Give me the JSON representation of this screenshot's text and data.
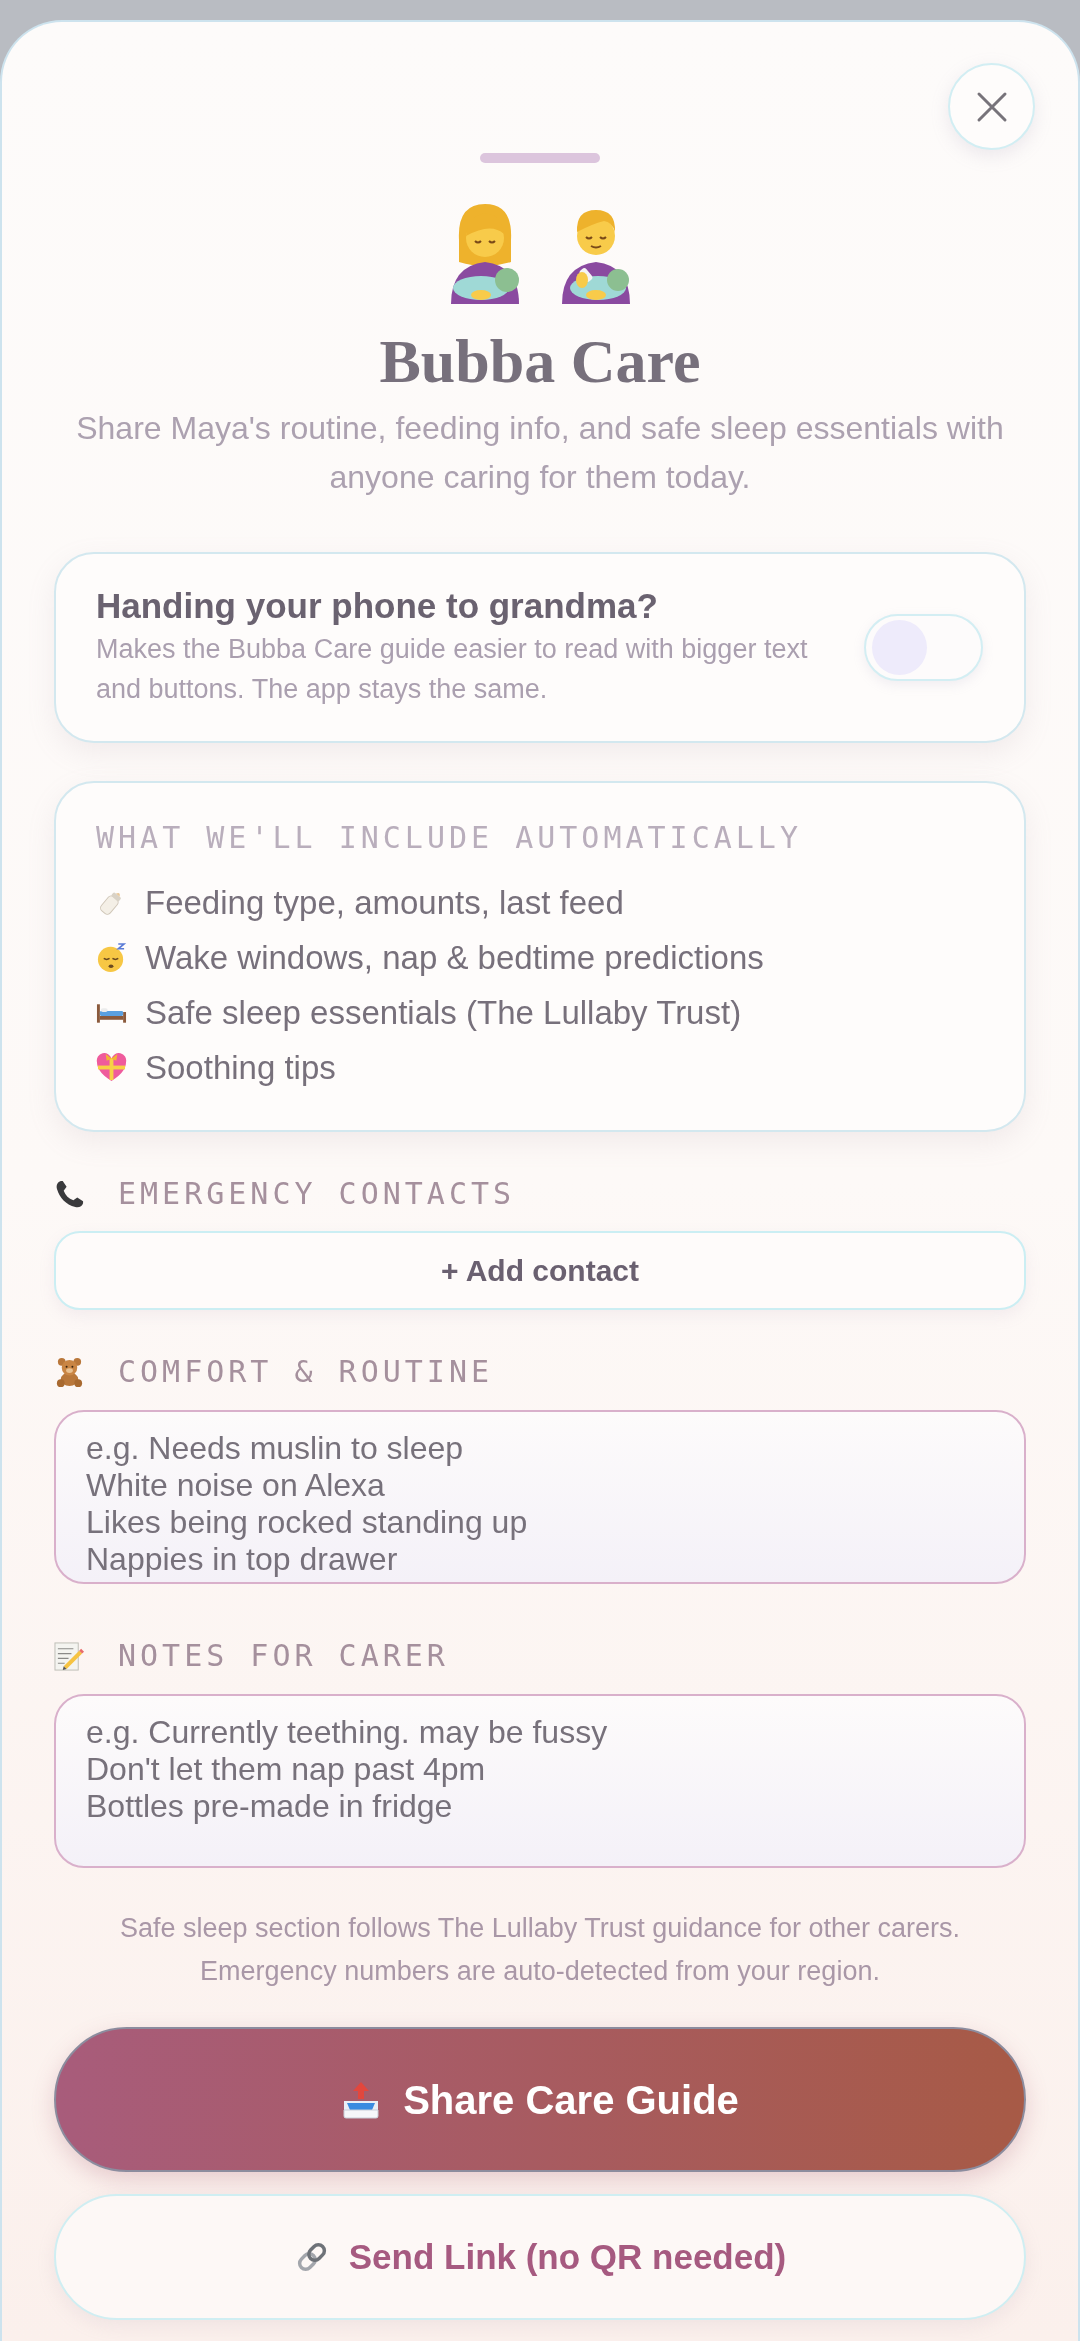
{
  "header": {
    "title": "Bubba Care",
    "subtitle": "Share Maya's routine, feeding info, and safe sleep essentials with anyone caring for them today."
  },
  "grandma_mode": {
    "title": "Handing your phone to grandma?",
    "description": "Makes the Bubba Care guide easier to read with bigger text and buttons. The app stays the same.",
    "on": false
  },
  "auto_include": {
    "heading": "WHAT WE'LL INCLUDE AUTOMATICALLY",
    "items": [
      "Feeding type, amounts, last feed",
      "Wake windows, nap & bedtime predictions",
      "Safe sleep essentials (The Lullaby Trust)",
      "Soothing tips"
    ]
  },
  "sections": [
    {
      "kind": "button",
      "heading": "EMERGENCY CONTACTS",
      "button": "+ Add contact"
    },
    {
      "kind": "textarea",
      "heading": "COMFORT & ROUTINE",
      "placeholder": "e.g. Needs muslin to sleep\nWhite noise on Alexa\nLikes being rocked standing up\nNappies in top drawer"
    },
    {
      "kind": "textarea",
      "heading": "NOTES FOR CARER",
      "placeholder": "e.g. Currently teething. may be fussy\nDon't let them nap past 4pm\nBottles pre-made in fridge"
    }
  ],
  "footnote": "Safe sleep section follows The Lullaby Trust guidance for other carers. Emergency numbers are auto-detected from your region.",
  "actions": [
    {
      "kind": "primary",
      "label": "Share Care Guide"
    },
    {
      "kind": "secondary",
      "label": "Send Link (no QR needed)"
    }
  ]
}
